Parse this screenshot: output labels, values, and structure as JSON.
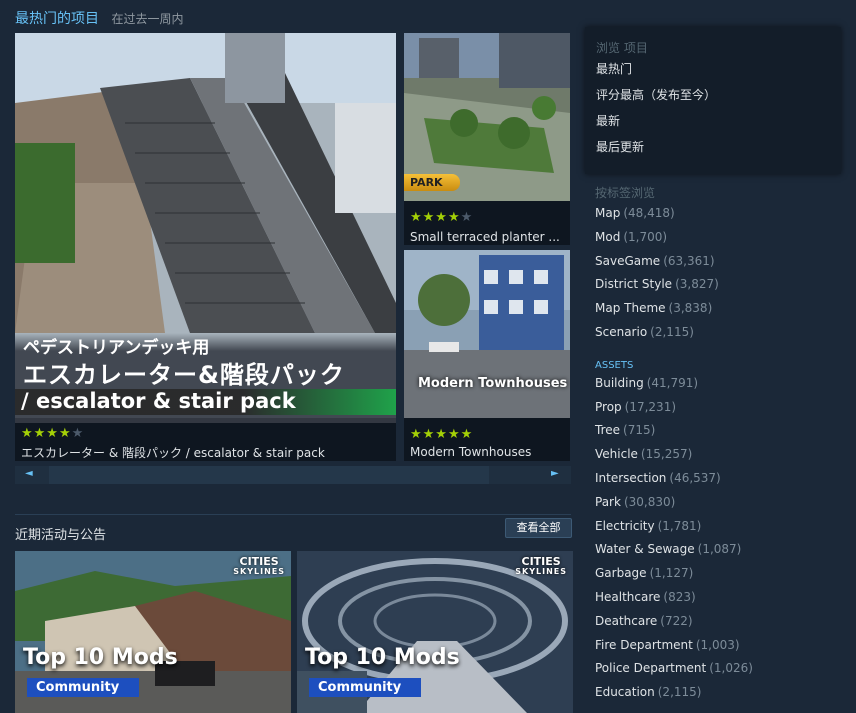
{
  "section": {
    "title": "最热门的项目",
    "period": "在过去一周内"
  },
  "featured": {
    "jp_line1": "ペデストリアンデッキ用",
    "jp_line2": "エスカレーター&階段パック",
    "en_line": "/ escalator & stair pack",
    "stars": "★★★★",
    "stars_off": "★",
    "caption": "エスカレーター & 階段パック / escalator & stair pack"
  },
  "items": [
    {
      "badge": "PARK",
      "stars": "★★★★",
      "stars_off": "★",
      "caption": "Small terraced planter ..."
    },
    {
      "overlay": "Modern Townhouses",
      "stars": "★★★★★",
      "stars_off": "",
      "caption": "Modern Townhouses"
    }
  ],
  "carousel": {
    "left_arrow": "◄",
    "right_arrow": "►"
  },
  "recent": {
    "title": "近期活动与公告",
    "view_all": "查看全部",
    "cards": [
      {
        "logo_top": "CITIES",
        "logo_bottom": "SKYLINES",
        "headline": "Top 10 Mods",
        "tag": "Community"
      },
      {
        "logo_top": "CITIES",
        "logo_bottom": "SKYLINES",
        "headline": "Top 10 Mods",
        "tag": "Community"
      }
    ]
  },
  "browse": {
    "header": "浏览 项目",
    "links": [
      "最热门",
      "评分最高（发布至今）",
      "最新",
      "最后更新"
    ]
  },
  "tags": {
    "header": "按标签浏览",
    "top": [
      {
        "name": "Map",
        "count": "(48,418)"
      },
      {
        "name": "Mod",
        "count": "(1,700)"
      },
      {
        "name": "SaveGame",
        "count": "(63,361)"
      },
      {
        "name": "District Style",
        "count": "(3,827)"
      },
      {
        "name": "Map Theme",
        "count": "(3,838)"
      },
      {
        "name": "Scenario",
        "count": "(2,115)"
      }
    ],
    "assets_header": "ASSETS",
    "assets": [
      {
        "name": "Building",
        "count": "(41,791)"
      },
      {
        "name": "Prop",
        "count": "(17,231)"
      },
      {
        "name": "Tree",
        "count": "(715)"
      },
      {
        "name": "Vehicle",
        "count": "(15,257)"
      },
      {
        "name": "Intersection",
        "count": "(46,537)"
      },
      {
        "name": "Park",
        "count": "(30,830)"
      },
      {
        "name": "Electricity",
        "count": "(1,781)"
      },
      {
        "name": "Water & Sewage",
        "count": "(1,087)"
      },
      {
        "name": "Garbage",
        "count": "(1,127)"
      },
      {
        "name": "Healthcare",
        "count": "(823)"
      },
      {
        "name": "Deathcare",
        "count": "(722)"
      },
      {
        "name": "Fire Department",
        "count": "(1,003)"
      },
      {
        "name": "Police Department",
        "count": "(1,026)"
      },
      {
        "name": "Education",
        "count": "(2,115)"
      }
    ]
  }
}
